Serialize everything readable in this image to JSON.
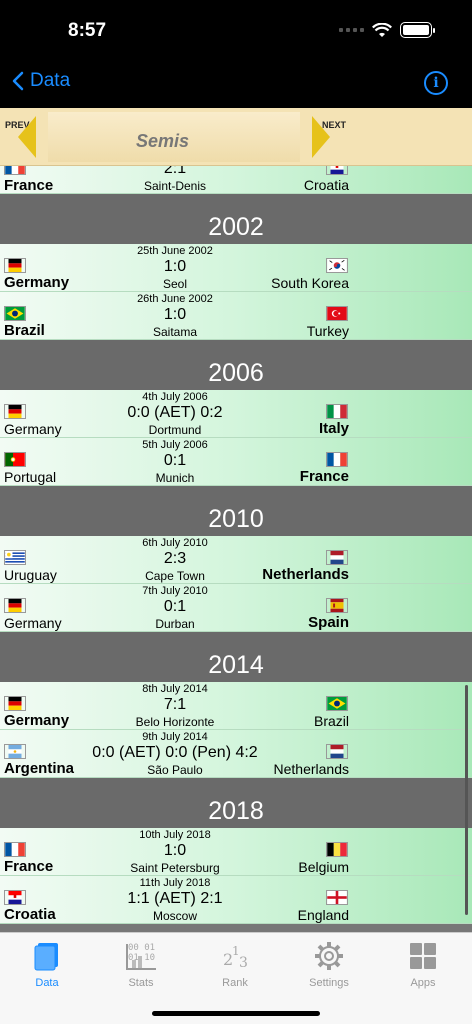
{
  "status": {
    "time": "8:57"
  },
  "nav": {
    "back_label": "Data",
    "info_glyph": "i"
  },
  "round": {
    "prev_label": "PREV",
    "next_label": "NEXT",
    "title": "Semis"
  },
  "partial_match": {
    "home": "France",
    "away": "Croatia",
    "score": "2:1",
    "venue": "Saint-Denis"
  },
  "sections": [
    {
      "year": "2002",
      "matches": [
        {
          "date": "25th June 2002",
          "home": "Germany",
          "away": "South Korea",
          "score": "1:0",
          "venue": "Seol"
        },
        {
          "date": "26th June 2002",
          "home": "Brazil",
          "away": "Turkey",
          "score": "1:0",
          "venue": "Saitama"
        }
      ]
    },
    {
      "year": "2006",
      "matches": [
        {
          "date": "4th July 2006",
          "home": "Germany",
          "away": "Italy",
          "score": "0:0  (AET) 0:2",
          "venue": "Dortmund"
        },
        {
          "date": "5th July 2006",
          "home": "Portugal",
          "away": "France",
          "score": "0:1",
          "venue": "Munich"
        }
      ]
    },
    {
      "year": "2010",
      "matches": [
        {
          "date": "6th July 2010",
          "home": "Uruguay",
          "away": "Netherlands",
          "score": "2:3",
          "venue": "Cape Town"
        },
        {
          "date": "7th July 2010",
          "home": "Germany",
          "away": "Spain",
          "score": "0:1",
          "venue": "Durban"
        }
      ]
    },
    {
      "year": "2014",
      "matches": [
        {
          "date": "8th July 2014",
          "home": "Germany",
          "away": "Brazil",
          "score": "7:1",
          "venue": "Belo Horizonte"
        },
        {
          "date": "9th July 2014",
          "home": "Argentina",
          "away": "Netherlands",
          "score": "0:0  (AET) 0:0  (Pen) 4:2",
          "venue": "São Paulo"
        }
      ]
    },
    {
      "year": "2018",
      "matches": [
        {
          "date": "10th July 2018",
          "home": "France",
          "away": "Belgium",
          "score": "1:0",
          "venue": "Saint Petersburg"
        },
        {
          "date": "11th July 2018",
          "home": "Croatia",
          "away": "England",
          "score": "1:1  (AET) 2:1",
          "venue": "Moscow"
        }
      ]
    }
  ],
  "tabs": [
    {
      "label": "Data",
      "icon": "book-icon",
      "active": true
    },
    {
      "label": "Stats",
      "icon": "stats-icon",
      "active": false
    },
    {
      "label": "Rank",
      "icon": "rank-icon",
      "active": false
    },
    {
      "label": "Settings",
      "icon": "gear-icon",
      "active": false
    },
    {
      "label": "Apps",
      "icon": "grid-icon",
      "active": false
    }
  ]
}
